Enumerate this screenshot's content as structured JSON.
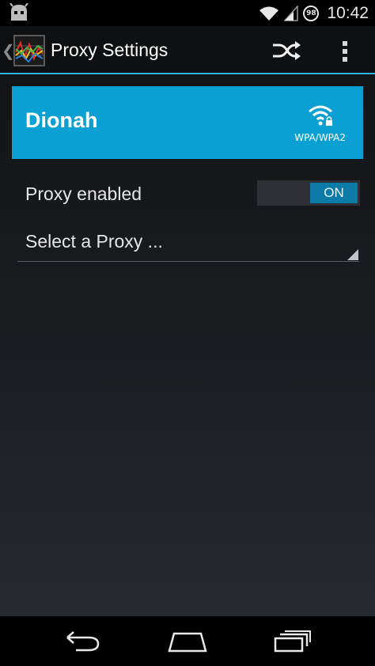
{
  "status_bar": {
    "time": "10:42",
    "battery_level": "98",
    "icons": [
      "cyanogenmod-icon",
      "wifi-icon",
      "signal-icon",
      "battery-icon"
    ]
  },
  "action_bar": {
    "title": "Proxy Settings",
    "accent_color": "#33b5e5",
    "icons": [
      "app-icon",
      "shuffle-icon",
      "overflow-menu-icon"
    ]
  },
  "network": {
    "ssid": "Dionah",
    "security": "WPA/WPA2",
    "card_color": "#0aa0d3"
  },
  "proxy": {
    "enabled_label": "Proxy enabled",
    "toggle_state": "ON",
    "select_placeholder": "Select a Proxy ..."
  },
  "nav_bar": {
    "icons": [
      "back-icon",
      "home-icon",
      "recents-icon"
    ]
  }
}
